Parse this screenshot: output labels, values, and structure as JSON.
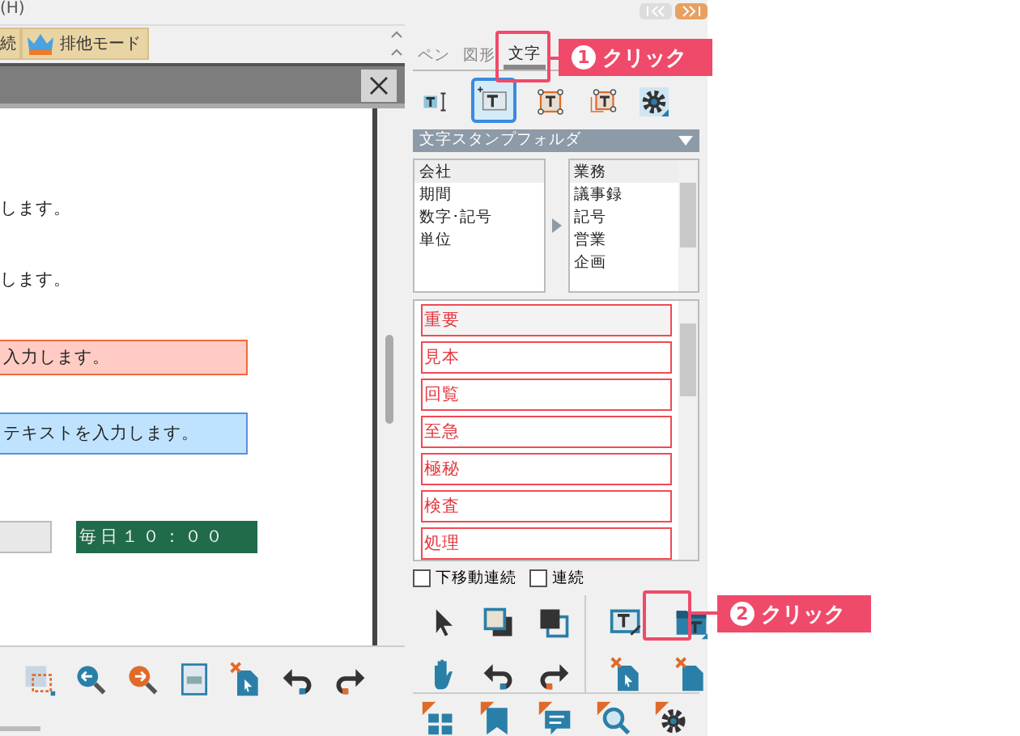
{
  "menu_bar": {
    "fragment": "(H)"
  },
  "toolbar": {
    "buttons": [
      {
        "label": "続"
      },
      {
        "label": "排他モード"
      }
    ]
  },
  "document": {
    "rows": [
      {
        "kind": "text",
        "text": "します。"
      },
      {
        "kind": "text",
        "text": "します。"
      },
      {
        "kind": "box",
        "text": "入力します。",
        "color": "#ffcbc3"
      },
      {
        "kind": "box",
        "text": "テキストを入力します。",
        "color": "#bfe3ff"
      },
      {
        "kind": "timer",
        "text": "毎日１０：００"
      }
    ]
  },
  "panel": {
    "tabs": [
      {
        "label": "ペン",
        "selected": false
      },
      {
        "label": "図形",
        "selected": false
      },
      {
        "label": "文字",
        "selected": true
      }
    ],
    "tools": [
      {
        "selected": false
      },
      {
        "selected": true
      },
      {
        "selected": false
      },
      {
        "selected": false
      },
      {
        "selected": false
      }
    ],
    "folder_header": "文字スタンプフォルダ",
    "folders": [
      {
        "label": "会社",
        "selected": true
      },
      {
        "label": "期間",
        "selected": false
      },
      {
        "label": "数字･記号",
        "selected": false
      },
      {
        "label": "単位",
        "selected": false
      }
    ],
    "subfolders": [
      {
        "label": "業務",
        "selected": true
      },
      {
        "label": "議事録",
        "selected": false
      },
      {
        "label": "記号",
        "selected": false
      },
      {
        "label": "営業",
        "selected": false
      },
      {
        "label": "企画",
        "selected": false
      }
    ],
    "stamps": [
      {
        "label": "重要",
        "selected": true
      },
      {
        "label": "見本",
        "selected": false
      },
      {
        "label": "回覧",
        "selected": false
      },
      {
        "label": "至急",
        "selected": false
      },
      {
        "label": "極秘",
        "selected": false
      },
      {
        "label": "検査",
        "selected": false
      },
      {
        "label": "処理",
        "selected": false
      }
    ],
    "checkboxes": [
      {
        "label": "下移動連続",
        "checked": false
      },
      {
        "label": "連続",
        "checked": false
      }
    ]
  },
  "annotations": [
    {
      "number": "1",
      "text": "クリック"
    },
    {
      "number": "2",
      "text": "クリック"
    }
  ]
}
